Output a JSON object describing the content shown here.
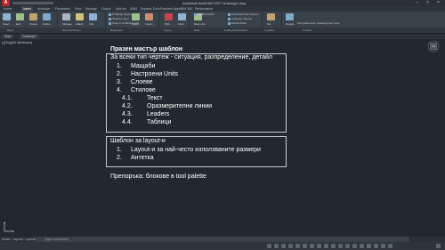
{
  "window": {
    "title": "Autodesk AutoCAD 2017   Drawing1.dwg"
  },
  "ribbon_tabs": [
    {
      "label": "Home",
      "active": false
    },
    {
      "label": "Insert",
      "active": true
    },
    {
      "label": "Annotate",
      "active": false
    },
    {
      "label": "Parametric",
      "active": false
    },
    {
      "label": "View",
      "active": false
    },
    {
      "label": "Manage",
      "active": false
    },
    {
      "label": "Output",
      "active": false
    },
    {
      "label": "Add-ins",
      "active": false
    },
    {
      "label": "A360",
      "active": false
    },
    {
      "label": "Express Tools",
      "active": false
    },
    {
      "label": "Featured Apps",
      "active": false
    },
    {
      "label": "BIM 360",
      "active": false
    },
    {
      "label": "Performance",
      "active": false
    }
  ],
  "ribbon": {
    "buttons": [
      {
        "label": "Insert",
        "color": "#8fb3d6"
      },
      {
        "label": "Edit",
        "color": "#9ec08a"
      },
      {
        "label": "Create",
        "color": "#c2a36e"
      },
      {
        "label": "Define",
        "color": "#7fa8c9"
      },
      {
        "label": "Manage",
        "color": "#a8b4bf"
      },
      {
        "label": "Attach",
        "color": "#d3c27a"
      },
      {
        "label": "Clip",
        "color": "#8fb3d6"
      },
      {
        "label": "Adjust",
        "color": "#9ec08a"
      },
      {
        "label": "Import",
        "color": "#c98f6e"
      },
      {
        "label": "PDF",
        "color": "#c4464a"
      },
      {
        "label": "Field",
        "color": "#8fb3d6"
      },
      {
        "label": "Data Link",
        "color": "#9ec08a"
      },
      {
        "label": "Set",
        "color": "#c2a36e"
      },
      {
        "label": "Design",
        "color": "#7fa8c9"
      }
    ],
    "small_items": {
      "underlay": "Underlay Layers",
      "frames": "*Frames vary*",
      "snap": "Snap to Underlays ON",
      "update_fields": "Update Fields",
      "upload": "Download from Source",
      "extract": "Upload to Source",
      "extract_data": "Extract Data",
      "find_location": "Find placement, drawings and more"
    },
    "panels": [
      "Block",
      "Block Definition",
      "Reference",
      "Import",
      "Data",
      "Linking & Extraction",
      "Location",
      "Content"
    ]
  },
  "file_tabs": [
    {
      "label": "Start"
    },
    {
      "label": "Drawing1*"
    }
  ],
  "viewport": {
    "label": "[-][Top][2D Wireframe]",
    "viewcube_label": "TOP"
  },
  "notes": {
    "heading": "Празен мастър шаблон",
    "box1_title": "За всеки тип чертеж - ситуация, разпределение, детайл",
    "list1": [
      {
        "num": "1.",
        "text": "Мащаби"
      },
      {
        "num": "2.",
        "text": "Настроени Units"
      },
      {
        "num": "3.",
        "text": "Слоеве"
      },
      {
        "num": "4.",
        "text": "Стилове"
      }
    ],
    "sublist": [
      {
        "num": "4.1.",
        "text": "Текст"
      },
      {
        "num": "4.2.",
        "text": "Оразмерителни линии"
      },
      {
        "num": "4.3.",
        "text": "Leaders"
      },
      {
        "num": "4.4.",
        "text": "Таблици"
      }
    ],
    "box2_title": "Шаблон за layout-и",
    "list2": [
      {
        "num": "1.",
        "text": "Layout-и за най-често използваните размери"
      },
      {
        "num": "2.",
        "text": "Антетка"
      }
    ],
    "recommendation": "Препоръка: блокове в tool palette"
  },
  "layout_tabs": [
    {
      "label": "Model"
    },
    {
      "label": "Layout1"
    },
    {
      "label": "Layout2"
    }
  ],
  "command_line": {
    "placeholder": "Type a command"
  },
  "colors": {
    "canvas": "#212830",
    "ribbon": "#39414a",
    "text": "#ffffff"
  }
}
